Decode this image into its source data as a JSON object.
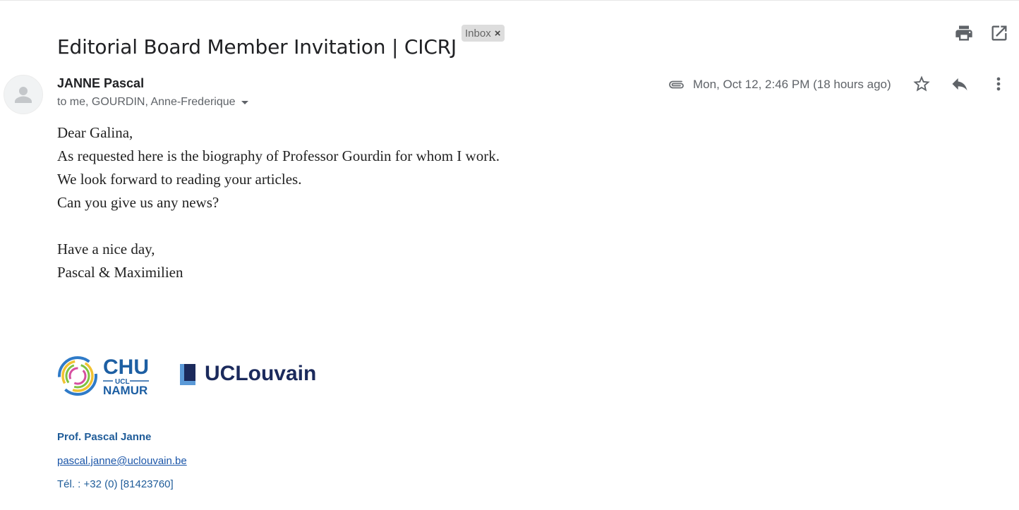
{
  "email": {
    "subject": "Editorial Board Member Invitation | CICRJ",
    "label": "Inbox",
    "label_remove": "×",
    "sender": "JANNE Pascal",
    "recipients": "to me, GOURDIN, Anne-Frederique",
    "timestamp": "Mon, Oct 12, 2:46 PM (18 hours ago)",
    "body_lines": [
      "Dear Galina,",
      "As requested here is the biography of Professor Gourdin for whom I work.",
      "We look forward to reading your articles.",
      "Can you give us any news?",
      "",
      "Have a nice day,",
      "Pascal & Maximilien"
    ]
  },
  "icons": {
    "print": "print-icon",
    "open_new_window": "open-in-new-window-icon",
    "attachment": "paperclip-icon",
    "star": "star-icon",
    "reply": "reply-icon",
    "more": "more-vertical-icon",
    "avatar": "default-avatar-icon"
  },
  "logos": {
    "chu": {
      "line1": "CHU",
      "line2": "UCL",
      "line3": "NAMUR"
    },
    "ucl": {
      "text": "UCLouvain"
    }
  },
  "signature": {
    "name": "Prof. Pascal Janne",
    "email": "pascal.janne@uclouvain.be",
    "tel": "Tél. : +32 (0) [81423760]"
  },
  "colors": {
    "signature_blue": "#1f5c99",
    "chu_blue": "#1d5fa3",
    "ucl_navy": "#1b2a5c",
    "ucl_square": "#4a8fd0",
    "text_gray": "#5f6368"
  }
}
